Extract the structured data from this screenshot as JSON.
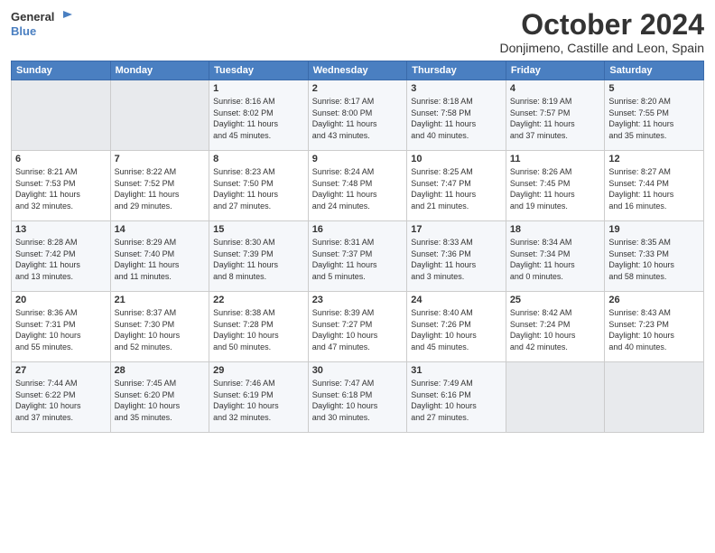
{
  "header": {
    "logo_line1": "General",
    "logo_line2": "Blue",
    "month": "October 2024",
    "location": "Donjimeno, Castille and Leon, Spain"
  },
  "days_of_week": [
    "Sunday",
    "Monday",
    "Tuesday",
    "Wednesday",
    "Thursday",
    "Friday",
    "Saturday"
  ],
  "weeks": [
    [
      {
        "day": "",
        "content": ""
      },
      {
        "day": "",
        "content": ""
      },
      {
        "day": "1",
        "content": "Sunrise: 8:16 AM\nSunset: 8:02 PM\nDaylight: 11 hours\nand 45 minutes."
      },
      {
        "day": "2",
        "content": "Sunrise: 8:17 AM\nSunset: 8:00 PM\nDaylight: 11 hours\nand 43 minutes."
      },
      {
        "day": "3",
        "content": "Sunrise: 8:18 AM\nSunset: 7:58 PM\nDaylight: 11 hours\nand 40 minutes."
      },
      {
        "day": "4",
        "content": "Sunrise: 8:19 AM\nSunset: 7:57 PM\nDaylight: 11 hours\nand 37 minutes."
      },
      {
        "day": "5",
        "content": "Sunrise: 8:20 AM\nSunset: 7:55 PM\nDaylight: 11 hours\nand 35 minutes."
      }
    ],
    [
      {
        "day": "6",
        "content": "Sunrise: 8:21 AM\nSunset: 7:53 PM\nDaylight: 11 hours\nand 32 minutes."
      },
      {
        "day": "7",
        "content": "Sunrise: 8:22 AM\nSunset: 7:52 PM\nDaylight: 11 hours\nand 29 minutes."
      },
      {
        "day": "8",
        "content": "Sunrise: 8:23 AM\nSunset: 7:50 PM\nDaylight: 11 hours\nand 27 minutes."
      },
      {
        "day": "9",
        "content": "Sunrise: 8:24 AM\nSunset: 7:48 PM\nDaylight: 11 hours\nand 24 minutes."
      },
      {
        "day": "10",
        "content": "Sunrise: 8:25 AM\nSunset: 7:47 PM\nDaylight: 11 hours\nand 21 minutes."
      },
      {
        "day": "11",
        "content": "Sunrise: 8:26 AM\nSunset: 7:45 PM\nDaylight: 11 hours\nand 19 minutes."
      },
      {
        "day": "12",
        "content": "Sunrise: 8:27 AM\nSunset: 7:44 PM\nDaylight: 11 hours\nand 16 minutes."
      }
    ],
    [
      {
        "day": "13",
        "content": "Sunrise: 8:28 AM\nSunset: 7:42 PM\nDaylight: 11 hours\nand 13 minutes."
      },
      {
        "day": "14",
        "content": "Sunrise: 8:29 AM\nSunset: 7:40 PM\nDaylight: 11 hours\nand 11 minutes."
      },
      {
        "day": "15",
        "content": "Sunrise: 8:30 AM\nSunset: 7:39 PM\nDaylight: 11 hours\nand 8 minutes."
      },
      {
        "day": "16",
        "content": "Sunrise: 8:31 AM\nSunset: 7:37 PM\nDaylight: 11 hours\nand 5 minutes."
      },
      {
        "day": "17",
        "content": "Sunrise: 8:33 AM\nSunset: 7:36 PM\nDaylight: 11 hours\nand 3 minutes."
      },
      {
        "day": "18",
        "content": "Sunrise: 8:34 AM\nSunset: 7:34 PM\nDaylight: 11 hours\nand 0 minutes."
      },
      {
        "day": "19",
        "content": "Sunrise: 8:35 AM\nSunset: 7:33 PM\nDaylight: 10 hours\nand 58 minutes."
      }
    ],
    [
      {
        "day": "20",
        "content": "Sunrise: 8:36 AM\nSunset: 7:31 PM\nDaylight: 10 hours\nand 55 minutes."
      },
      {
        "day": "21",
        "content": "Sunrise: 8:37 AM\nSunset: 7:30 PM\nDaylight: 10 hours\nand 52 minutes."
      },
      {
        "day": "22",
        "content": "Sunrise: 8:38 AM\nSunset: 7:28 PM\nDaylight: 10 hours\nand 50 minutes."
      },
      {
        "day": "23",
        "content": "Sunrise: 8:39 AM\nSunset: 7:27 PM\nDaylight: 10 hours\nand 47 minutes."
      },
      {
        "day": "24",
        "content": "Sunrise: 8:40 AM\nSunset: 7:26 PM\nDaylight: 10 hours\nand 45 minutes."
      },
      {
        "day": "25",
        "content": "Sunrise: 8:42 AM\nSunset: 7:24 PM\nDaylight: 10 hours\nand 42 minutes."
      },
      {
        "day": "26",
        "content": "Sunrise: 8:43 AM\nSunset: 7:23 PM\nDaylight: 10 hours\nand 40 minutes."
      }
    ],
    [
      {
        "day": "27",
        "content": "Sunrise: 7:44 AM\nSunset: 6:22 PM\nDaylight: 10 hours\nand 37 minutes."
      },
      {
        "day": "28",
        "content": "Sunrise: 7:45 AM\nSunset: 6:20 PM\nDaylight: 10 hours\nand 35 minutes."
      },
      {
        "day": "29",
        "content": "Sunrise: 7:46 AM\nSunset: 6:19 PM\nDaylight: 10 hours\nand 32 minutes."
      },
      {
        "day": "30",
        "content": "Sunrise: 7:47 AM\nSunset: 6:18 PM\nDaylight: 10 hours\nand 30 minutes."
      },
      {
        "day": "31",
        "content": "Sunrise: 7:49 AM\nSunset: 6:16 PM\nDaylight: 10 hours\nand 27 minutes."
      },
      {
        "day": "",
        "content": ""
      },
      {
        "day": "",
        "content": ""
      }
    ]
  ]
}
